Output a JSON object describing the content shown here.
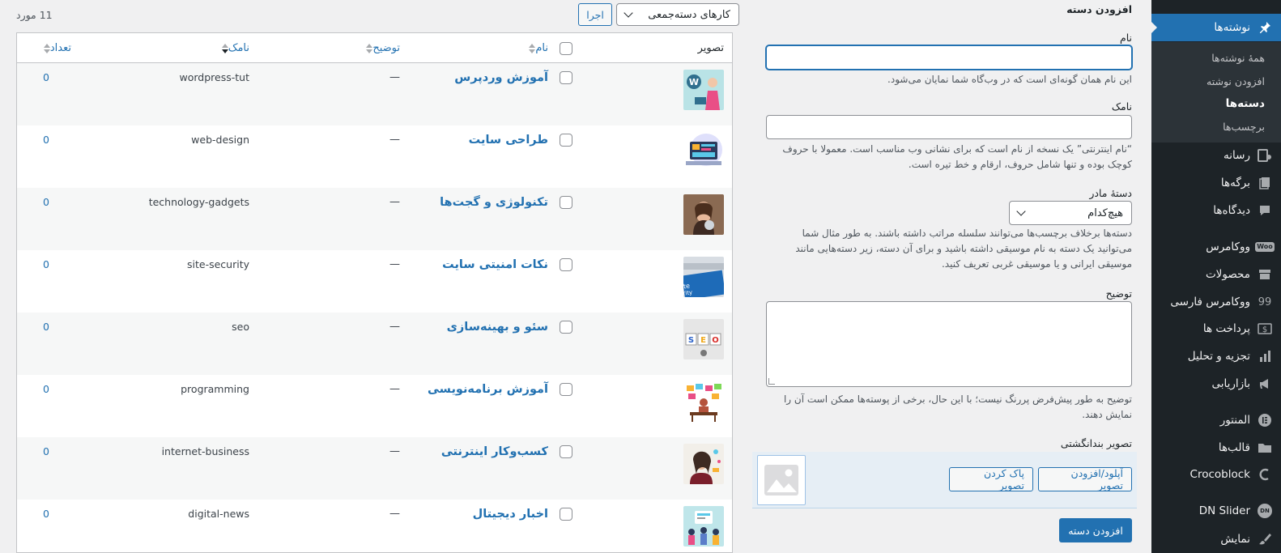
{
  "sidebar": {
    "posts": "نوشته‌ها",
    "sub": {
      "all_posts": "همهٔ نوشته‌ها",
      "add_post": "افزودن نوشته",
      "categories": "دسته‌ها",
      "tags": "برچسب‌ها"
    },
    "media": "رسانه",
    "pages": "برگه‌ها",
    "comments": "دیدگاه‌ها",
    "woocommerce": "ووکامرس",
    "woo_badge": "Woo",
    "products": "محصولات",
    "woocommerce_farsi": "ووکامرس فارسی",
    "payments": "پرداخت ها",
    "analytics": "تجزیه و تحلیل",
    "marketing": "بازاریابی",
    "elementor": "المنتور",
    "templates": "قالب‌ها",
    "crocoblock": "Crocoblock",
    "dn_slider": "DN Slider",
    "dn_badge": "DN",
    "appearance": "نمایش"
  },
  "form": {
    "title": "افزودن دسته",
    "name_label": "نام",
    "name_value": "",
    "name_hint": "این نام همان گونه‌ای است که در وب‌گاه شما نمایان می‌شود.",
    "slug_label": "نامک",
    "slug_value": "",
    "slug_hint": "“نام اینترنتی” یک نسخه از نام است که برای نشانی وب مناسب است. معمولا با حروف کوچک بوده و تنها شامل حروف، ارقام و خط تیره است.",
    "parent_label": "دستهٔ مادر",
    "parent_value": "هیچ‌کدام",
    "parent_hint": "دسته‌ها برخلاف برچسب‌ها می‌توانند سلسله مراتب داشته باشند. به طور مثال شما می‌توانید یک دسته به نام موسیقی داشته باشید و برای آن دسته، زیر دسته‌هایی مانند موسیقی ایرانی و یا موسیقی غربی تعریف کنید.",
    "desc_label": "توضیح",
    "desc_value": "",
    "desc_hint": "توضیح به طور پیش‌فرض پررنگ نیست؛ با این حال، برخی از پوسته‌ها ممکن است آن را نمایش دهند.",
    "thumb_label": "تصویر بندانگشتی",
    "upload_btn": "آپلود/افزودن تصویر",
    "remove_btn": "پاک کردن تصویر",
    "submit": "افزودن دسته"
  },
  "table": {
    "bulk_actions": "کارهای دسته‌جمعی",
    "apply": "اجرا",
    "count": "11 مورد",
    "headers": {
      "image": "تصویر",
      "name": "نام",
      "description": "توضیح",
      "slug": "نامک",
      "count": "تعداد"
    },
    "rows": [
      {
        "name": "آموزش وردپرس",
        "desc": "—",
        "slug": "wordpress-tut",
        "count": "0"
      },
      {
        "name": "طراحی سایت",
        "desc": "—",
        "slug": "web-design",
        "count": "0"
      },
      {
        "name": "تکنولوژی و گجت‌ها",
        "desc": "—",
        "slug": "technology-gadgets",
        "count": "0"
      },
      {
        "name": "نکات امنیتی سایت",
        "desc": "—",
        "slug": "site-security",
        "count": "0"
      },
      {
        "name": "سئو و بهینه‌سازی",
        "desc": "—",
        "slug": "seo",
        "count": "0"
      },
      {
        "name": "آموزش برنامه‌نویسی",
        "desc": "—",
        "slug": "programming",
        "count": "0"
      },
      {
        "name": "کسب‌وکار اینترنتی",
        "desc": "—",
        "slug": "internet-business",
        "count": "0"
      },
      {
        "name": "اخبار دیجیتال",
        "desc": "—",
        "slug": "digital-news",
        "count": "0"
      }
    ]
  },
  "colors": {
    "accent": "#2271b1",
    "sidebar_bg": "#1d2327",
    "page_bg": "#f0f0f1"
  }
}
